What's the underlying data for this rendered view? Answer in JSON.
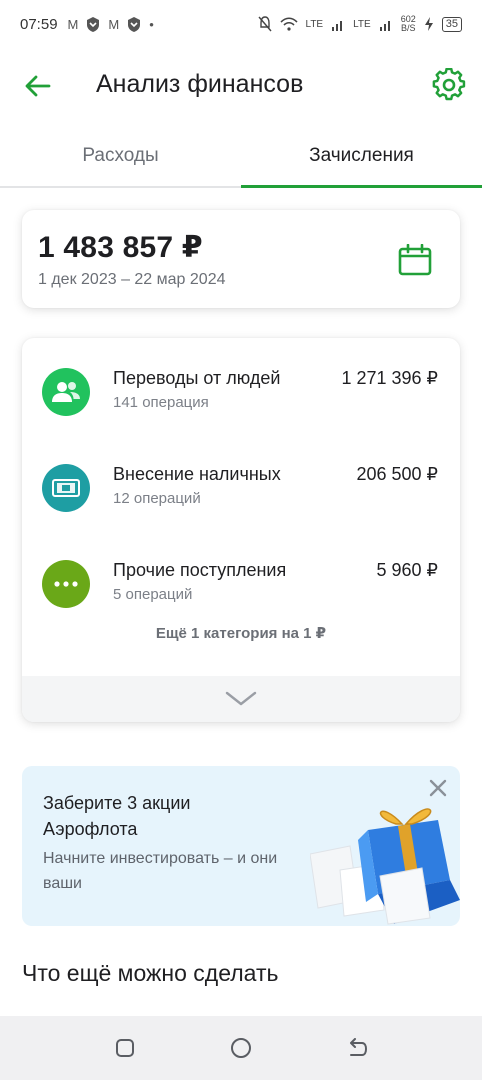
{
  "status_bar": {
    "time": "07:59",
    "icons": [
      "M",
      "shield",
      "M",
      "shield",
      "•"
    ],
    "network": "LTE",
    "speed": "602",
    "speed_unit": "B/S",
    "battery": "35"
  },
  "header": {
    "title": "Анализ финансов"
  },
  "tabs": [
    {
      "label": "Расходы",
      "active": false
    },
    {
      "label": "Зачисления",
      "active": true
    }
  ],
  "summary": {
    "amount": "1 483 857 ₽",
    "period": "1 дек 2023 – 22 мар 2024"
  },
  "categories": [
    {
      "name": "Переводы от людей",
      "count": "141 операция",
      "amount": "1 271 396 ₽",
      "icon": "people-icon",
      "color": "#21c25e"
    },
    {
      "name": "Внесение наличных",
      "count": "12 операций",
      "amount": "206 500 ₽",
      "icon": "cash-icon",
      "color": "#1e9ea3"
    },
    {
      "name": "Прочие поступления",
      "count": "5 операций",
      "amount": "5 960 ₽",
      "icon": "more-dots-icon",
      "color": "#6aa818"
    }
  ],
  "more_categories": "Ещё 1 категория на 1 ₽",
  "promo": {
    "title": "Заберите 3 акции Аэрофлота",
    "subtitle": "Начните инвестировать – и они ваши"
  },
  "section_title": "Что ещё можно сделать",
  "colors": {
    "accent": "#21a038",
    "promo_bg": "#e6f4fc"
  }
}
